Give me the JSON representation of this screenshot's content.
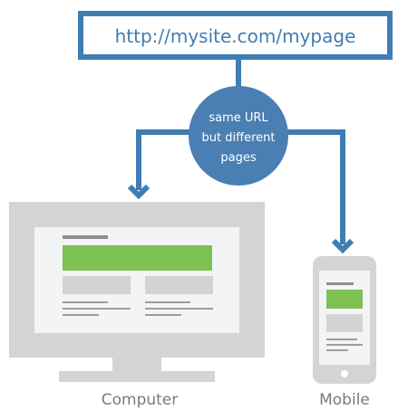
{
  "url_box": {
    "text": "http://mysite.com/mypage"
  },
  "bubble": {
    "lines": [
      "same URL",
      "but different",
      "pages"
    ]
  },
  "devices": {
    "computer_label": "Computer",
    "mobile_label": "Mobile"
  },
  "colors": {
    "accent_blue": "#3f7db3",
    "bubble_blue": "#4a7fb3",
    "device_gray": "#d4d4d4",
    "screen_bg": "#f3f4f5",
    "placeholder_green": "#7cc152",
    "placeholder_gray": "#d3d3d3",
    "line_gray": "#a0a0a0",
    "label_gray": "#7a7a7a"
  }
}
